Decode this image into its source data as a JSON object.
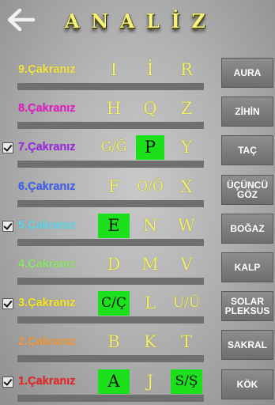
{
  "header": {
    "title_letters": [
      "A",
      "N",
      "A",
      "L",
      "İ",
      "Z"
    ]
  },
  "colors": {
    "letter_yellow": "#f1ee72",
    "selected_green": "#1de01d",
    "button_gray": "#7d7d7d"
  },
  "rows": [
    {
      "label": "9.Çakranız",
      "color": "#f4e63c",
      "checked": false,
      "letters": [
        "I",
        "İ",
        "R"
      ],
      "selected": [
        false,
        false,
        false
      ],
      "button": "AURA"
    },
    {
      "label": "8.Çakranız",
      "color": "#ea16c8",
      "checked": false,
      "letters": [
        "H",
        "Q",
        "Z"
      ],
      "selected": [
        false,
        false,
        false
      ],
      "button": "ZİHİN"
    },
    {
      "label": "7.Çakranız",
      "color": "#9b25e6",
      "checked": true,
      "letters": [
        "G/Ğ",
        "P",
        "Y"
      ],
      "selected": [
        false,
        true,
        false
      ],
      "button": "TAÇ"
    },
    {
      "label": "6.Çakranız",
      "color": "#3d5df0",
      "checked": false,
      "letters": [
        "F",
        "O/Ö",
        "X"
      ],
      "selected": [
        false,
        false,
        false
      ],
      "button": "ÜÇÜNCÜ\nGÖZ"
    },
    {
      "label": "5.Çakranız",
      "color": "#5ed8ee",
      "checked": true,
      "letters": [
        "E",
        "N",
        "W"
      ],
      "selected": [
        true,
        false,
        false
      ],
      "button": "BOĞAZ"
    },
    {
      "label": "4.Çakranız",
      "color": "#8ee86a",
      "checked": false,
      "letters": [
        "D",
        "M",
        "V"
      ],
      "selected": [
        false,
        false,
        false
      ],
      "button": "KALP"
    },
    {
      "label": "3.Çakranız",
      "color": "#f6e71e",
      "checked": true,
      "letters": [
        "C/Ç",
        "L",
        "U/Ü"
      ],
      "selected": [
        true,
        false,
        false
      ],
      "button": "SOLAR\nPLEKSUS"
    },
    {
      "label": "2.Çakranız",
      "color": "#f39a3a",
      "checked": false,
      "letters": [
        "B",
        "K",
        "T"
      ],
      "selected": [
        false,
        false,
        false
      ],
      "button": "SAKRAL"
    },
    {
      "label": "1.Çakranız",
      "color": "#f02020",
      "checked": true,
      "letters": [
        "A",
        "J",
        "S/Ş"
      ],
      "selected": [
        true,
        false,
        true
      ],
      "button": "KÖK"
    }
  ]
}
